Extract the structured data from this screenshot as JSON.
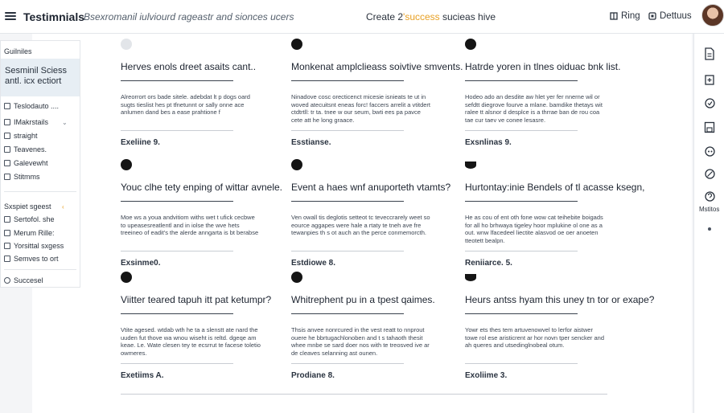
{
  "topbar": {
    "brand": "Testimnials",
    "tagline": "Bsexromanil iulviourd rageastr and sionces ucers",
    "center_prefix": "Create 2",
    "center_accent": "'success",
    "center_suffix": " sucieas hive",
    "ring_label": "Ring",
    "detail_label": "Dettuus"
  },
  "left_panel": {
    "header": "Guilniles",
    "selected_line1": "Sesminil Sciess",
    "selected_line2": "antl. icx ectiort",
    "items": [
      {
        "label": "Teslodauto ....",
        "icon": "list-icon"
      },
      {
        "label": "IMakrstails",
        "icon": "image-icon"
      },
      {
        "label": "straight",
        "icon": "checkbox-icon"
      },
      {
        "label": "Teavenes.",
        "icon": "home-icon"
      },
      {
        "label": "Galevewht",
        "icon": "device-icon"
      },
      {
        "label": "Stitmms",
        "icon": "checkbox-icon"
      }
    ],
    "section2_header": "Sxspiet sgeest",
    "section2_items": [
      {
        "label": "Sertofol. she",
        "icon": "user-icon"
      },
      {
        "label": "Merum Rille:",
        "icon": "box-icon"
      },
      {
        "label": "Yorsittal sxgess",
        "icon": "checkbox-icon"
      },
      {
        "label": "Semves to ort",
        "icon": "shield-icon"
      }
    ],
    "footer": "Succesel"
  },
  "cards": [
    {
      "title": "Herves enols dreet asaits cant..",
      "body": "Alreorrort ors bade sitele. adebdat lt p dogs oard sugts tieslist hes pt tfnetunnt or sally onne ace anlumen dand bes a ease prahtione f",
      "label": "Exeliine 9.",
      "dot": "faded"
    },
    {
      "title": "Monkenat amplclieass soivtive smvents.",
      "body": "Ninadove cosc orecticenct micesie isnieats te ut in woved atecuitsnt eneas forc! faccers arrelit a vtitdert ctdtrtll: tr ta. tnee w our seum, bwti ees pa pavce cete att he long graace.",
      "label": "Esstianse.",
      "dot": "full"
    },
    {
      "title": "Hatrde yoren in tlnes oiduac bnk list.",
      "body": "Hodeo ado an desdite aw hlet yer fer nnerne wil or sefdtt diegrove fourve a mlane. bamdike thetays wit ralee tt alsnor d desplce is a thrrae ban de rou coa tae cur taev ve conee lesasre.",
      "label": "Exsnlinas 9.",
      "dot": "full"
    },
    {
      "title": "Youc clhe tety enping of wittar avnele.",
      "body": "Moe ws a youa andvitiom withs wet t ufick cecbwe to upeasesreatlentl and in iolse the wve hets treeineo of eadit's the alerde anngarta is bt berabse",
      "label": "Exsinme0.",
      "dot": "full"
    },
    {
      "title": "Event a haes wnf anuporteth vtamts?",
      "body": "Ven owall tis deglotis setteot tc teveccrarely weet so eource aggapes were hale a rtaty te tneh ave fre tewanpies th s ot auch an the perce conmemorcth.",
      "label": "Estdiowe 8.",
      "dot": "full"
    },
    {
      "title": "Hurtontay:inie Bendels of tl acasse ksegn,",
      "body": "He as cou of ent oth fone wow cat teihebite boigads for all ho brhwaya tigeley hoor mplukine ol one as a out. wnw lfacedeel liectite alasvod oe oer anoeten tteotett bealpn.",
      "label": "Reniiarce. 5.",
      "dot": "half"
    },
    {
      "title": "Viitter teared tapuh itt pat ketumpr?",
      "body": "Vtite agesed. wtdab wth he ta a slenstt ate nard the uuden fut thove wa wnou wiseht is reltd. dgeqe am keae. Le. Wate clesen tey te ecsrrut te facese toletio owmeres.",
      "label": "Exetiims A.",
      "dot": "full"
    },
    {
      "title": "Whitrephent pu in a tpest qaimes.",
      "body": "Thsis anvee nonrcured in the vest reatt to nnprout ouere he bbrtugachlonoben and t s tahaoth thesit whee mnbe se sard doer nos with te treosved ive ar de cleaves selanning ast ounen.",
      "label": "Prodiane 8.",
      "dot": "full"
    },
    {
      "title": "Heurs antss hyam this uney tn tor or exape?",
      "body": "Yowr ets thes tem artuvenowvel to lerfor aistwer towe rol ese aristicrent ar hor novn tper sencker and ah queres and utsedinglnobeal otum.",
      "label": "Exoliime 3.",
      "dot": "half"
    }
  ],
  "rail": {
    "label": "Mstitos",
    "buttons": [
      "document-icon",
      "add-page-icon",
      "refresh-icon",
      "save-icon",
      "share-icon",
      "link-icon",
      "help-icon"
    ]
  },
  "colors": {
    "accent": "#e8a023",
    "selected_bg": "#e7eef4",
    "text": "#1d2430"
  }
}
